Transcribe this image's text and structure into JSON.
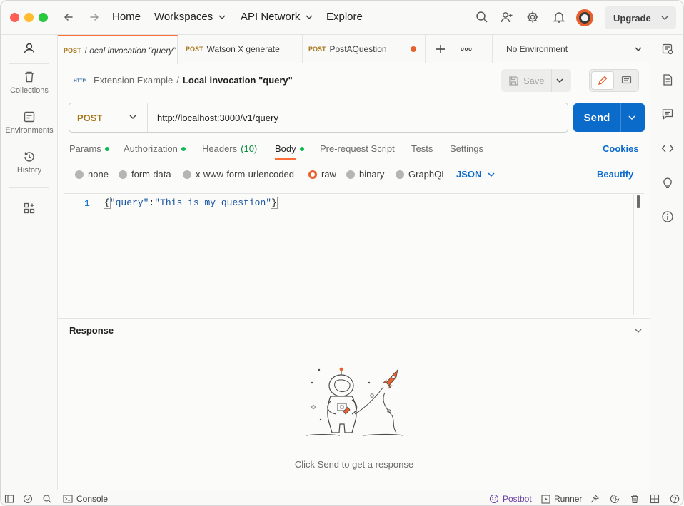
{
  "header": {
    "nav": [
      "Home",
      "Workspaces",
      "API Network",
      "Explore"
    ],
    "upgrade_label": "Upgrade"
  },
  "sidebar": {
    "items": [
      {
        "label": "",
        "icon": "user-icon"
      },
      {
        "label": "Collections",
        "icon": "trash-can-icon"
      },
      {
        "label": "Environments",
        "icon": "environment-icon"
      },
      {
        "label": "History",
        "icon": "history-icon"
      },
      {
        "label": "",
        "icon": "grid-plus-icon"
      }
    ]
  },
  "tabs": [
    {
      "method": "POST",
      "name": "Local invocation \"query\"",
      "active": true
    },
    {
      "method": "POST",
      "name": "Watson X generate",
      "active": false
    },
    {
      "method": "POST",
      "name": "PostAQuestion",
      "active": false,
      "unsaved": true
    }
  ],
  "environment": {
    "selected": "No Environment"
  },
  "breadcrumb": {
    "collection": "Extension Example",
    "separator": "/",
    "request": "Local invocation \"query\""
  },
  "save_label": "Save",
  "request": {
    "method": "POST",
    "url": "http://localhost:3000/v1/query",
    "send_label": "Send"
  },
  "request_tabs": {
    "params": "Params",
    "authorization": "Authorization",
    "headers": "Headers",
    "headers_count": "(10)",
    "body": "Body",
    "prerequest": "Pre-request Script",
    "tests": "Tests",
    "settings": "Settings",
    "cookies": "Cookies"
  },
  "body_types": {
    "none": "none",
    "form_data": "form-data",
    "urlencoded": "x-www-form-urlencoded",
    "raw": "raw",
    "binary": "binary",
    "graphql": "GraphQL",
    "format": "JSON",
    "beautify": "Beautify",
    "selected": "raw"
  },
  "editor": {
    "line_number": "1",
    "open_brace": "{",
    "key": "\"query\"",
    "colon": ":",
    "value": "\"This is my question\"",
    "close_brace": "}"
  },
  "response": {
    "title": "Response",
    "hint": "Click Send to get a response"
  },
  "statusbar": {
    "console": "Console",
    "postbot": "Postbot",
    "runner": "Runner"
  },
  "colors": {
    "accent": "#ff6c37",
    "send": "#0b6bcb",
    "method_post": "#a7761b",
    "link": "#0b6bcb"
  }
}
